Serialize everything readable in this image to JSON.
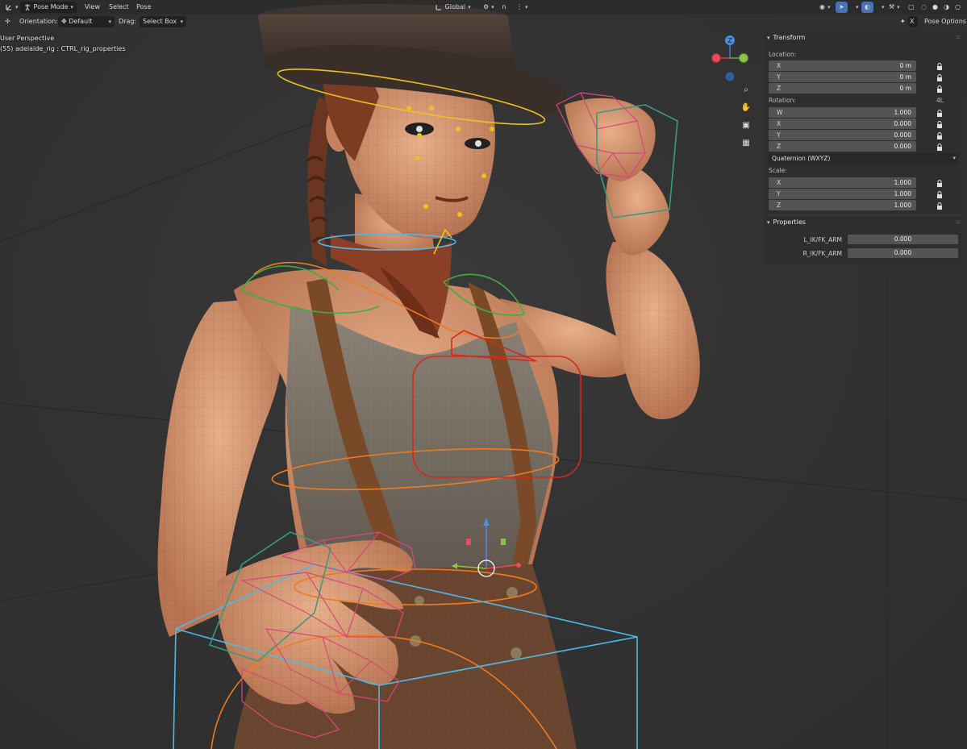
{
  "header": {
    "mode": "Pose Mode",
    "menu": [
      "View",
      "Select",
      "Pose"
    ],
    "transform_orientation": "Global",
    "pose_options": "Pose Options",
    "close_glyph": "X"
  },
  "toolbar": {
    "orientation_label": "Orientation:",
    "orientation_value": "Default",
    "drag_label": "Drag:",
    "drag_value": "Select Box"
  },
  "viewport": {
    "perspective": "User Perspective",
    "active_object": "(55) adelaide_rig : CTRL_rig_properties",
    "gizmo_axis": "Z"
  },
  "sidebar": {
    "transform": {
      "title": "Transform",
      "location_label": "Location:",
      "location": [
        {
          "axis": "X",
          "value": "0 m"
        },
        {
          "axis": "Y",
          "value": "0 m"
        },
        {
          "axis": "Z",
          "value": "0 m"
        }
      ],
      "rotation_label": "Rotation:",
      "rotation_mode_short": "4L",
      "rotation": [
        {
          "axis": "W",
          "value": "1.000"
        },
        {
          "axis": "X",
          "value": "0.000"
        },
        {
          "axis": "Y",
          "value": "0.000"
        },
        {
          "axis": "Z",
          "value": "0.000"
        }
      ],
      "rotation_mode": "Quaternion (WXYZ)",
      "scale_label": "Scale:",
      "scale": [
        {
          "axis": "X",
          "value": "1.000"
        },
        {
          "axis": "Y",
          "value": "1.000"
        },
        {
          "axis": "Z",
          "value": "1.000"
        }
      ]
    },
    "properties": {
      "title": "Properties",
      "items": [
        {
          "label": "L_IK/FK_ARM",
          "value": "0.000"
        },
        {
          "label": "R_IK/FK_ARM",
          "value": "0.000"
        }
      ]
    }
  },
  "colors": {
    "accent": "#4772b3",
    "axis_x": "#e84a5f",
    "axis_y": "#8bc34a",
    "axis_z": "#4a8ee8",
    "bone_pink": "#d9467a",
    "bone_cyan": "#4cb9e8",
    "bone_orange": "#f07a1e",
    "bone_red": "#d42a1e",
    "bone_green": "#3fae3f",
    "bone_yellow": "#f0c020",
    "bone_teal": "#3a9a7a"
  }
}
